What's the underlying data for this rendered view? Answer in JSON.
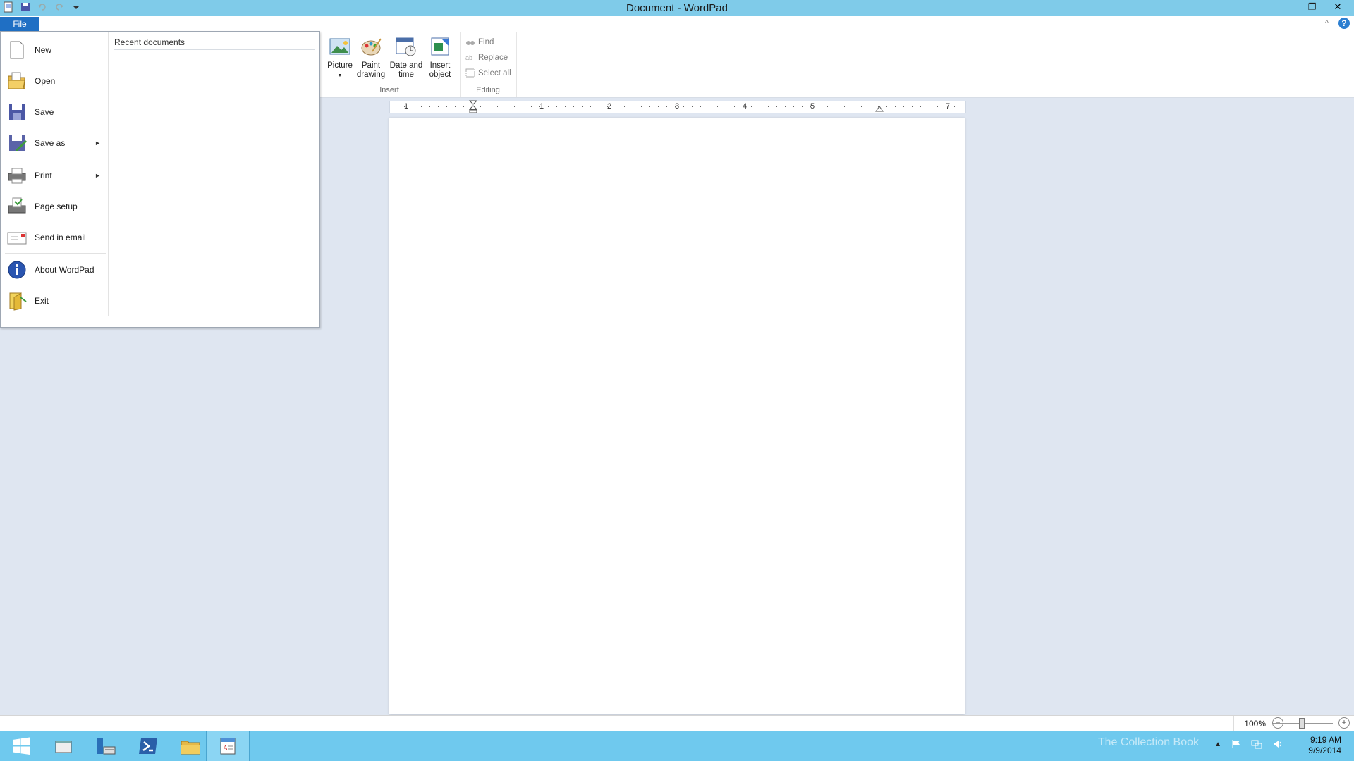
{
  "window": {
    "title": "Document - WordPad"
  },
  "title_controls": {
    "minimize": "–",
    "restore": "❐",
    "close": "✕"
  },
  "ribbon": {
    "help": "?",
    "collapse": "^",
    "insert_group": {
      "label": "Insert",
      "buttons": [
        {
          "label": "Picture",
          "has_dropdown": true
        },
        {
          "label": "Paint drawing"
        },
        {
          "label": "Date and time"
        },
        {
          "label": "Insert object"
        }
      ]
    },
    "editing_group": {
      "label": "Editing",
      "buttons": [
        {
          "label": "Find"
        },
        {
          "label": "Replace"
        },
        {
          "label": "Select all"
        }
      ]
    }
  },
  "ruler": {
    "numbers": [
      "1",
      "1",
      "2",
      "3",
      "4",
      "5",
      "7"
    ]
  },
  "file_menu": {
    "tab_label": "File",
    "items": [
      {
        "label": "New",
        "icon": "new-document-icon"
      },
      {
        "label": "Open",
        "icon": "open-folder-icon"
      },
      {
        "label": "Save",
        "icon": "floppy-disk-icon"
      },
      {
        "label": "Save as",
        "icon": "save-as-icon",
        "submenu": true
      },
      {
        "label": "Print",
        "icon": "printer-icon",
        "submenu": true
      },
      {
        "label": "Page setup",
        "icon": "page-setup-icon"
      },
      {
        "label": "Send in email",
        "icon": "email-icon"
      },
      {
        "label": "About WordPad",
        "icon": "info-icon"
      },
      {
        "label": "Exit",
        "icon": "exit-icon"
      }
    ],
    "recent_title": "Recent documents"
  },
  "status": {
    "zoom": "100%"
  },
  "taskbar": {
    "time": "9:19 AM",
    "date": "9/9/2014",
    "watermark": "The Collection Book"
  },
  "colors": {
    "titlebar": "#7fcbe9",
    "taskbar": "#6fc9ee",
    "file_tab": "#1f6fc4"
  }
}
